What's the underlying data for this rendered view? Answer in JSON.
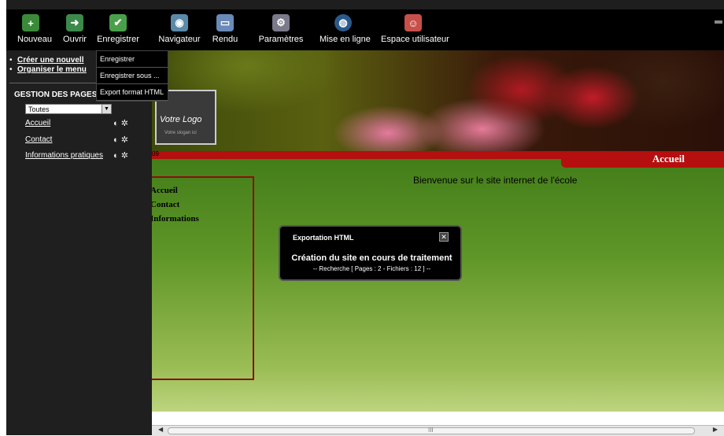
{
  "toolbar": {
    "nouveau": "Nouveau",
    "ouvrir": "Ouvrir",
    "enregistrer": "Enregistrer",
    "navigateur": "Navigateur",
    "rendu": "Rendu",
    "parametres": "Paramètres",
    "mise_en_ligne": "Mise en ligne",
    "espace_utilisateur": "Espace utilisateur"
  },
  "menu": {
    "items": [
      "Enregistrer",
      "Enregistrer sous ...",
      "Export format HTML"
    ]
  },
  "sidebar": {
    "link_create": "Créer une nouvell",
    "link_organize": "Organiser le menu",
    "section_title": "GESTION DES PAGES",
    "filter_value": "Toutes",
    "pages": [
      "Accueil",
      "Contact",
      "Informations pratiques"
    ]
  },
  "preview": {
    "logo_text": "Votre Logo",
    "logo_sub": "Votre slogan ici",
    "bar_text": "09",
    "tab_title": "Accueil",
    "nav": [
      "Accueil",
      "Contact",
      "Informations"
    ],
    "welcome": "Bienvenue sur le site internet de l'école"
  },
  "dialog": {
    "title": "Exportation HTML",
    "main": "Création du site en cours de traitement",
    "sub": "-- Recherche [ Pages : 2 - Fichiers : 12 ] --"
  },
  "scrollbar": {
    "grip": "III"
  },
  "colors": {
    "accent_red": "#b50f0f",
    "toolbar_bg": "#000000",
    "sidebar_bg": "#1f1f1f"
  },
  "icons": [
    "plus-icon",
    "open-arrow-icon",
    "save-check-icon",
    "browser-icon",
    "render-icon",
    "settings-gear-icon",
    "globe-icon",
    "user-space-icon",
    "edit-icon",
    "tools-icon"
  ]
}
